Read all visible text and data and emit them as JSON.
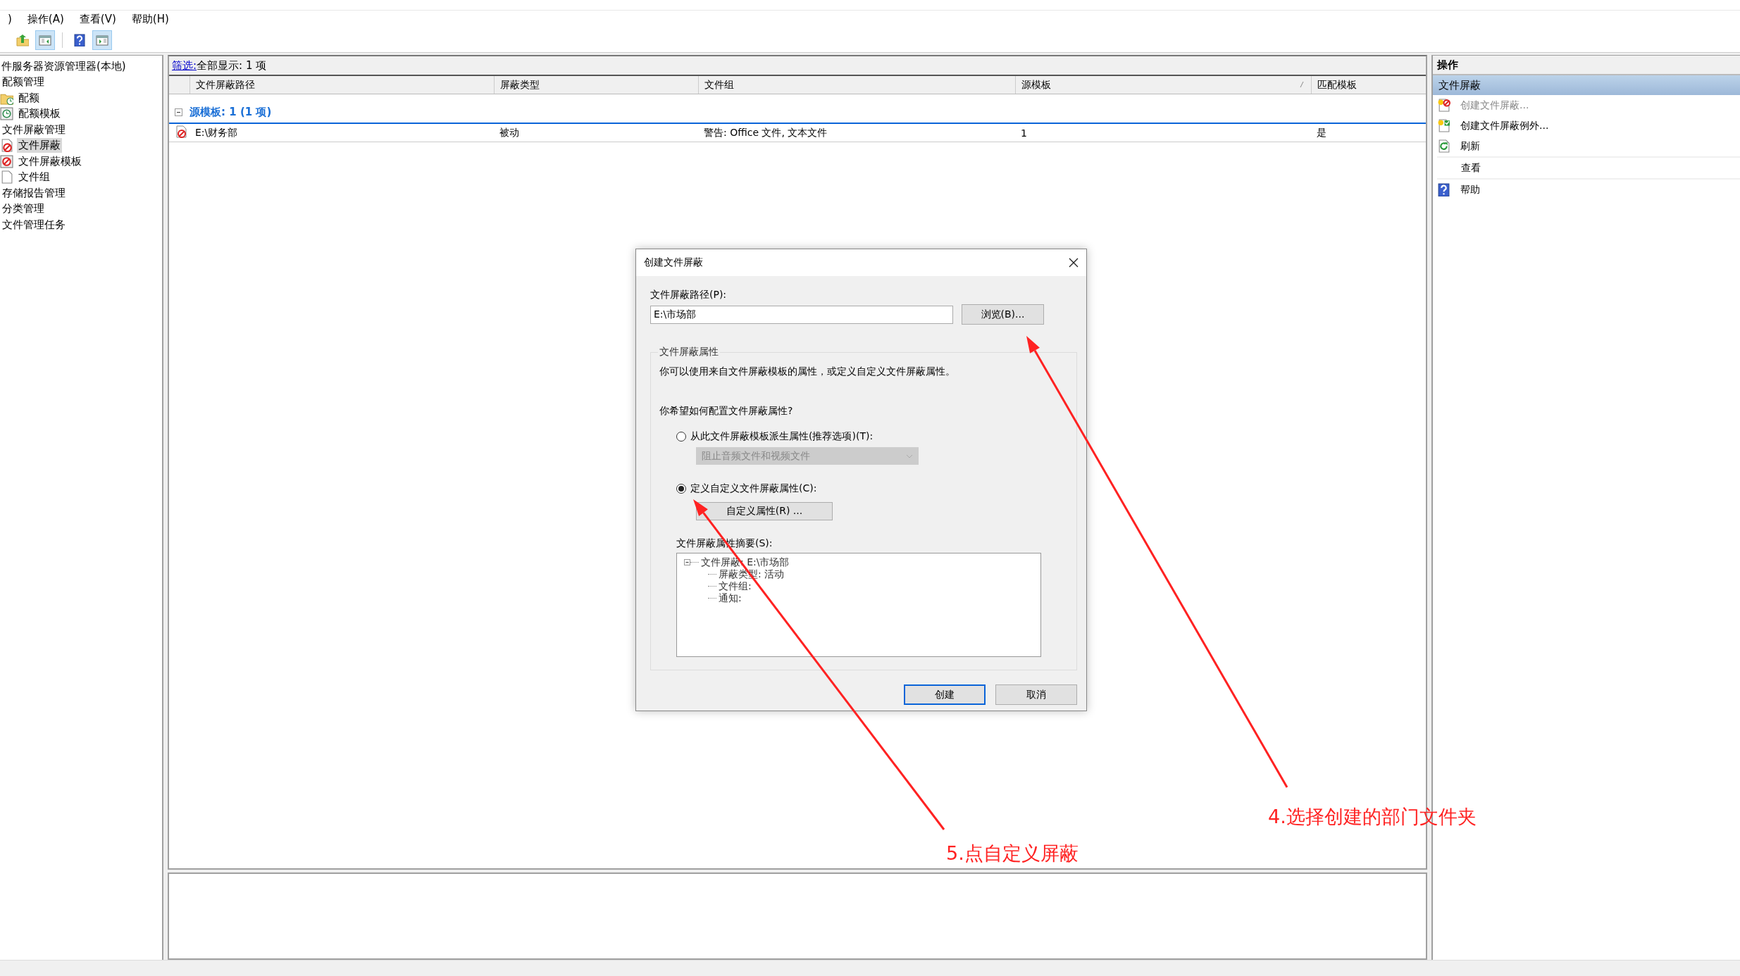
{
  "menu_bar": [
    ")",
    "操作(A)",
    "查看(V)",
    "帮助(H)"
  ],
  "toolbar": [
    {
      "kind": "up",
      "pressed": false
    },
    {
      "kind": "console-tree",
      "pressed": true
    },
    {
      "kind": "help",
      "pressed": false
    },
    {
      "kind": "action-pane",
      "pressed": true
    }
  ],
  "tree": [
    {
      "label": "件服务器资源管理器(本地)",
      "selected": false,
      "children": [
        {
          "label": "配额管理",
          "selected": false,
          "children": [
            {
              "label": "配额",
              "selected": false
            },
            {
              "label": "配额模板",
              "selected": false
            }
          ]
        },
        {
          "label": "文件屏蔽管理",
          "selected": false,
          "children": [
            {
              "label": "文件屏蔽",
              "selected": true
            },
            {
              "label": "文件屏蔽模板",
              "selected": false
            },
            {
              "label": "文件组",
              "selected": false
            }
          ]
        },
        {
          "label": "存储报告管理",
          "selected": false
        },
        {
          "label": "分类管理",
          "selected": false
        },
        {
          "label": "文件管理任务",
          "selected": false
        }
      ]
    }
  ],
  "list": {
    "filter_link": "筛选:",
    "filter_text": "全部显示: 1 项",
    "columns": [
      {
        "label": "文件屏蔽路径",
        "sorted": false
      },
      {
        "label": "屏蔽类型",
        "sorted": false
      },
      {
        "label": "文件组",
        "sorted": false
      },
      {
        "label": "源模板",
        "sorted": true
      },
      {
        "label": "匹配模板",
        "sorted": false
      }
    ],
    "groups": [
      {
        "label": "源模板: 1 (1 项)",
        "expanded": true,
        "rows": [
          {
            "cells": [
              "E:\\财务部",
              "被动",
              "警告: Office 文件, 文本文件",
              "1",
              "是"
            ]
          }
        ]
      }
    ]
  },
  "actions": {
    "title": "操作",
    "section": "文件屏蔽",
    "items": [
      {
        "label": "创建文件屏蔽...",
        "disabled": true
      },
      {
        "label": "创建文件屏蔽例外...",
        "disabled": false
      },
      {
        "label": "刷新",
        "disabled": false
      },
      {
        "label": "查看",
        "disabled": false
      },
      {
        "label": "帮助",
        "disabled": false
      }
    ]
  },
  "dialog": {
    "title": "创建文件屏蔽",
    "path_label": "文件屏蔽路径(P):",
    "path_value": "E:\\市场部",
    "browse_button": "浏览(B)...",
    "group_title": "文件屏蔽属性",
    "description": "你可以使用来自文件屏蔽模板的属性，或定义自定义文件屏蔽属性。",
    "question": "你希望如何配置文件屏蔽属性?",
    "options": [
      {
        "kind": "dropdown",
        "label": "从此文件屏蔽模板派生属性(推荐选项)(T):",
        "selected": false,
        "control": "阻止音频文件和视频文件",
        "disabled": true
      },
      {
        "kind": "button",
        "label": "定义自定义文件屏蔽属性(C):",
        "selected": true,
        "control": "自定义属性(R) ...",
        "disabled": false
      }
    ],
    "summary_label": "文件屏蔽属性摘要(S):",
    "summary_tree": [
      {
        "label": "文件屏蔽: E:\\市场部",
        "expanded": true,
        "children": [
          {
            "label": "屏蔽类型: 活动"
          },
          {
            "label": "文件组:"
          },
          {
            "label": "通知:"
          }
        ]
      }
    ],
    "buttons": [
      {
        "label": "创建",
        "default": true
      },
      {
        "label": "取消",
        "default": false
      }
    ]
  },
  "annotations": [
    {
      "text": "4.选择创建的部门文件夹"
    },
    {
      "text": "5.点自定义屏蔽"
    }
  ]
}
